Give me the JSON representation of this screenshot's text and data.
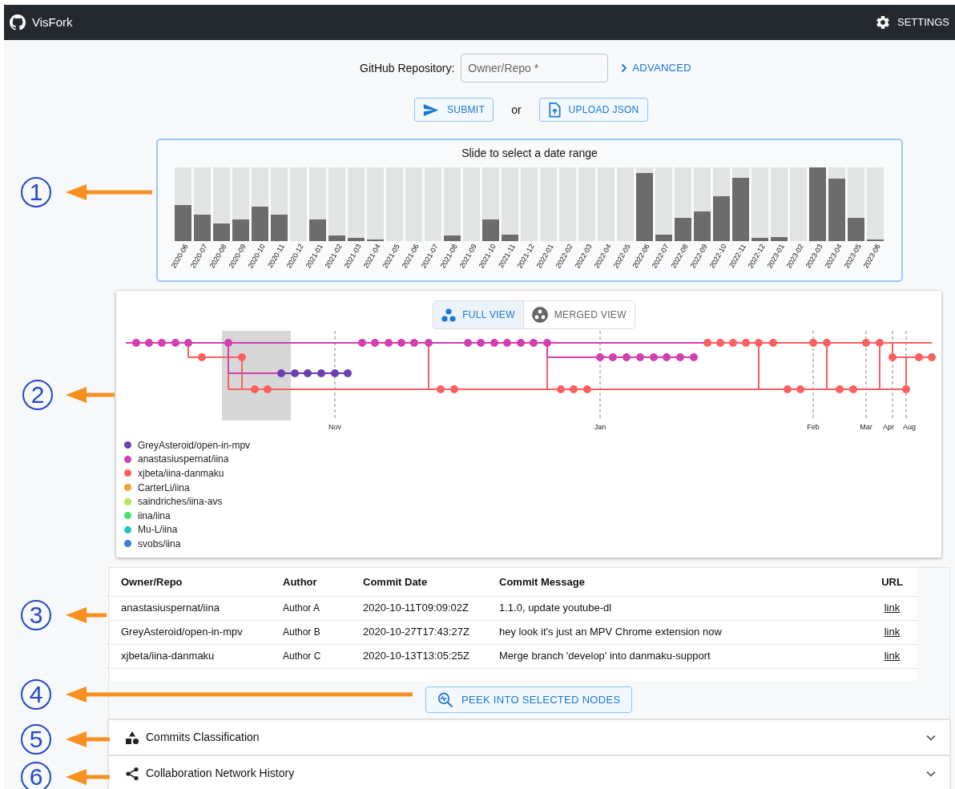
{
  "app_bar": {
    "title": "VisFork",
    "settings": "SETTINGS"
  },
  "repo_form": {
    "label": "GitHub Repository:",
    "placeholder": "Owner/Repo *",
    "advanced": "ADVANCED",
    "submit": "SUBMIT",
    "or": "or",
    "upload": "UPLOAD JSON"
  },
  "date_range": {
    "title": "Slide to select a date range",
    "months": [
      {
        "label": "2020-06",
        "level": 0.49
      },
      {
        "label": "2020-07",
        "level": 0.36
      },
      {
        "label": "2020-08",
        "level": 0.24
      },
      {
        "label": "2020-09",
        "level": 0.29
      },
      {
        "label": "2020-10",
        "level": 0.47
      },
      {
        "label": "2020-11",
        "level": 0.36
      },
      {
        "label": "2020-12",
        "level": 0
      },
      {
        "label": "2021-01",
        "level": 0.29
      },
      {
        "label": "2021-02",
        "level": 0.08
      },
      {
        "label": "2021-03",
        "level": 0.04
      },
      {
        "label": "2021-04",
        "level": 0.02
      },
      {
        "label": "2021-05",
        "level": 0
      },
      {
        "label": "2021-06",
        "level": 0
      },
      {
        "label": "2021-07",
        "level": 0
      },
      {
        "label": "2021-08",
        "level": 0.08
      },
      {
        "label": "2021-09",
        "level": 0
      },
      {
        "label": "2021-10",
        "level": 0.29
      },
      {
        "label": "2021-11",
        "level": 0.09
      },
      {
        "label": "2021-12",
        "level": 0
      },
      {
        "label": "2022-01",
        "level": 0
      },
      {
        "label": "2022-02",
        "level": 0
      },
      {
        "label": "2022-03",
        "level": 0
      },
      {
        "label": "2022-04",
        "level": 0
      },
      {
        "label": "2022-05",
        "level": 0
      },
      {
        "label": "2022-06",
        "level": 0.92
      },
      {
        "label": "2022-07",
        "level": 0.09
      },
      {
        "label": "2022-08",
        "level": 0.31
      },
      {
        "label": "2022-09",
        "level": 0.4
      },
      {
        "label": "2022-10",
        "level": 0.61
      },
      {
        "label": "2022-11",
        "level": 0.86
      },
      {
        "label": "2022-12",
        "level": 0.04
      },
      {
        "label": "2023-01",
        "level": 0.05
      },
      {
        "label": "2023-02",
        "level": 0
      },
      {
        "label": "2023-03",
        "level": 1
      },
      {
        "label": "2023-04",
        "level": 0.85
      },
      {
        "label": "2023-05",
        "level": 0.31
      },
      {
        "label": "2023-06",
        "level": 0.02
      }
    ]
  },
  "commit_graph": {
    "view_toggle": [
      {
        "label": "FULL VIEW",
        "selected": true
      },
      {
        "label": "MERGED VIEW",
        "selected": false
      }
    ],
    "axis_ticks": [
      "Nov",
      "Jan",
      "Feb",
      "Mar",
      "Apr",
      "Aug"
    ],
    "legend": [
      {
        "label": "GreyAsteroid/open-in-mpv",
        "color": "#6b3fae"
      },
      {
        "label": "anastasiuspernat/iina",
        "color": "#d13fb0"
      },
      {
        "label": "xjbeta/iina-danmaku",
        "color": "#fb5f5f"
      },
      {
        "label": "CarterLi/iina",
        "color": "#f0a232"
      },
      {
        "label": "saindriches/iina-avs",
        "color": "#b2ea58"
      },
      {
        "label": "iina/iina",
        "color": "#3fe270"
      },
      {
        "label": "Mu-L/iina",
        "color": "#1ec9c0"
      },
      {
        "label": "svobs/iina",
        "color": "#3b7ddf"
      }
    ]
  },
  "commit_table": {
    "columns": [
      "Owner/Repo",
      "Author",
      "Commit Date",
      "Commit Message",
      "URL"
    ],
    "rows": [
      [
        "anastasiuspernat/iina",
        "Author A",
        "2020-10-11T09:09:02Z",
        "1.1.0, update youtube-dl",
        "link"
      ],
      [
        "GreyAsteroid/open-in-mpv",
        "Author B",
        "2020-10-27T17:43:27Z",
        "hey look it's just an MPV Chrome extension now",
        "link"
      ],
      [
        "xjbeta/iina-danmaku",
        "Author C",
        "2020-10-13T13:05:25Z",
        "Merge branch 'develop' into danmaku-support",
        "link"
      ]
    ]
  },
  "peek_button": "PEEK INTO SELECTED NODES",
  "accordions": [
    {
      "kind": "shapes",
      "title": "Commits Classification",
      "expanded": false
    },
    {
      "kind": "share",
      "title": "Collaboration Network History",
      "expanded": false
    }
  ],
  "annotations": [
    {
      "number": "1"
    },
    {
      "number": "2"
    },
    {
      "number": "3"
    },
    {
      "number": "4"
    },
    {
      "number": "5"
    },
    {
      "number": "6"
    }
  ]
}
